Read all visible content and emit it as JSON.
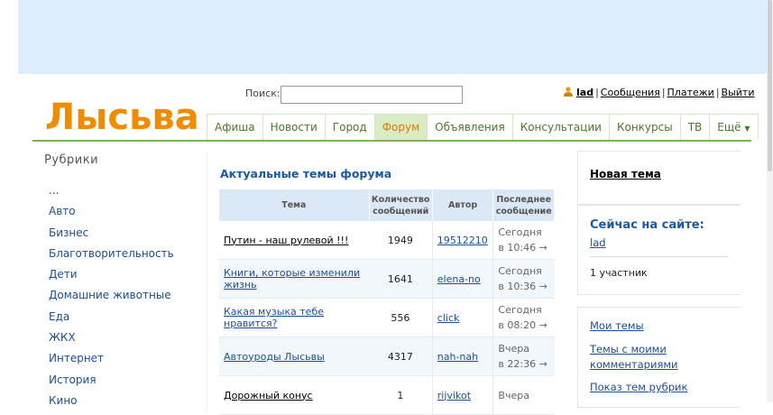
{
  "site": {
    "logo": "Лысьва"
  },
  "search": {
    "label": "Поиск:",
    "value": ""
  },
  "userbar": {
    "username": "lad",
    "messages": "Сообщения",
    "payments": "Платежи",
    "logout": "Выйти"
  },
  "nav": {
    "tabs": [
      "Афиша",
      "Новости",
      "Город",
      "Форум",
      "Объявления",
      "Консультации",
      "Конкурсы",
      "ТВ",
      "Ещё"
    ]
  },
  "sidebar": {
    "title": "Рубрики",
    "items": [
      "...",
      "Авто",
      "Бизнес",
      "Благотворительность",
      "Дети",
      "Домашние животные",
      "Еда",
      "ЖКХ",
      "Интернет",
      "История",
      "Кино"
    ]
  },
  "forum": {
    "title": "Актуальные темы форума",
    "columns": {
      "topic": "Тема",
      "count": "Количество сообщений",
      "author": "Автор",
      "last": "Последнее сообщение"
    },
    "rows": [
      {
        "topic": "Путин - наш рулевой !!!",
        "count": "1949",
        "author": "19512210",
        "day": "Сегодня",
        "time": "в 10:46 →"
      },
      {
        "topic": "Книги, которые изменили жизнь",
        "count": "1641",
        "author": "elena-no",
        "day": "Сегодня",
        "time": "в 10:36 →"
      },
      {
        "topic": "Какая музыка тебе нравится?",
        "count": "556",
        "author": "click",
        "day": "Сегодня",
        "time": "в 08:20 →"
      },
      {
        "topic": "Автоуроды Лысьвы",
        "count": "4317",
        "author": "nah-nah",
        "day": "Вчера",
        "time": "в 22:36 →"
      },
      {
        "topic": "Дорожный конус",
        "count": "1",
        "author": "rijvikot",
        "day": "Вчера",
        "time": ""
      }
    ]
  },
  "right": {
    "new_topic": "Новая тема",
    "online_title": "Сейчас на сайте:",
    "online_user": "lad",
    "online_count": "1 участник",
    "links": [
      "Мои темы",
      "Темы с моими комментариями",
      "Показ тем рубрик"
    ]
  },
  "colors": {
    "accent_orange": "#f08c00",
    "nav_green": "#4b7a26",
    "link_blue": "#1a4f9a",
    "header_band": "#ddeeff"
  }
}
